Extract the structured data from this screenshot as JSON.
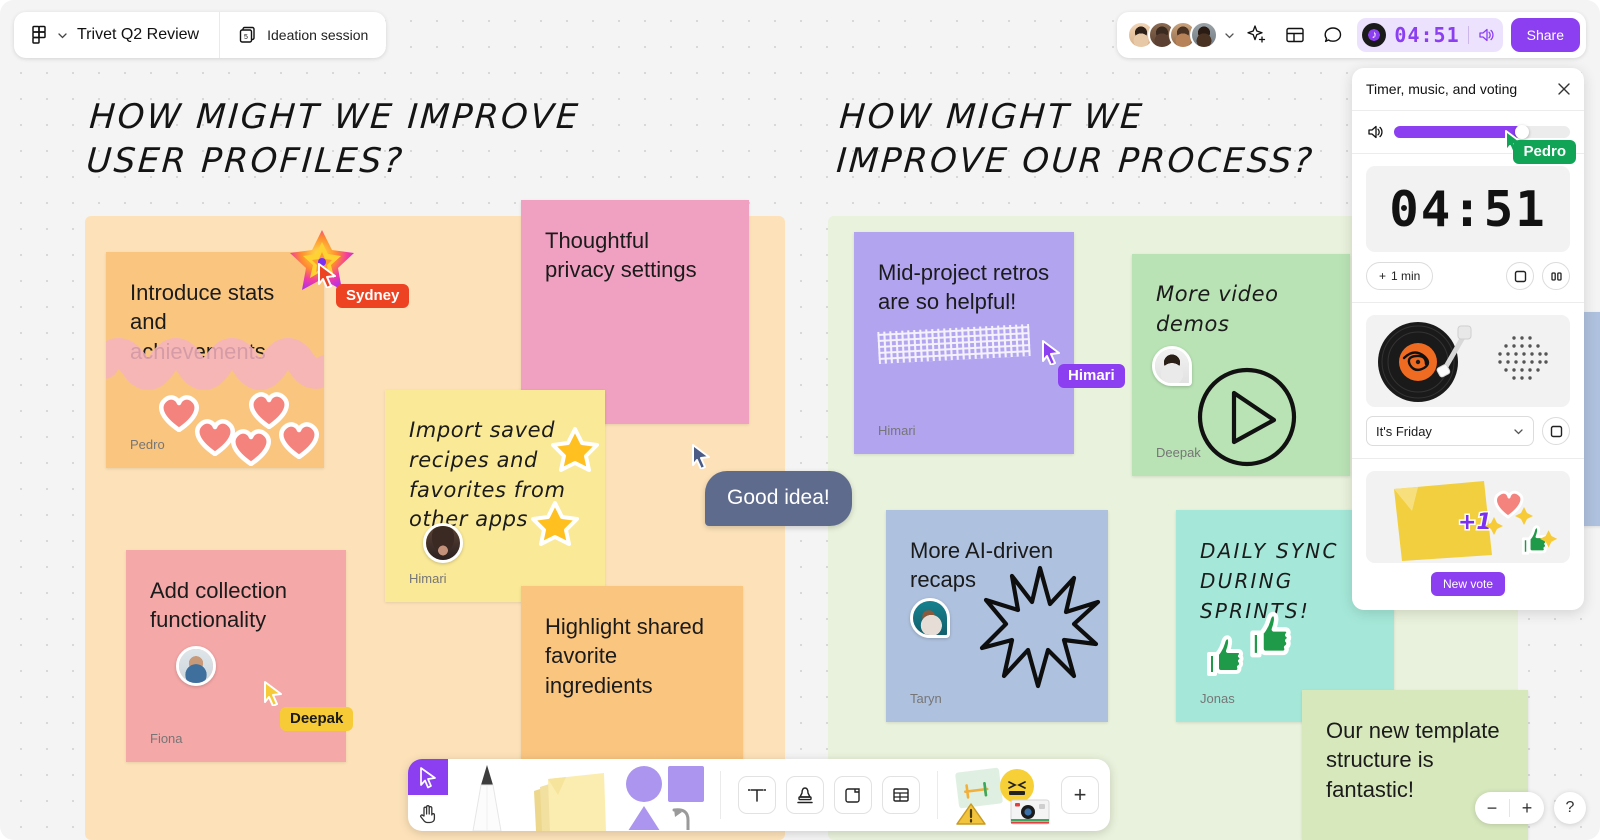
{
  "topbar": {
    "doc_title": "Trivet Q2 Review",
    "tab_label": "Ideation session",
    "tab_badge": "5",
    "timer_display": "04:51",
    "share_label": "Share",
    "icons": {
      "figjam_logo": "figjam-logo-icon",
      "chevron": "chevron-down-icon",
      "pages": "pages-icon",
      "sparkle": "sparkle-ai-icon",
      "template": "template-icon",
      "comment": "comment-bubble-icon",
      "music": "music-disc-icon",
      "volume": "volume-icon"
    }
  },
  "panel": {
    "title": "Timer, music, and voting",
    "close": "×",
    "volume_percent": 73,
    "timer": {
      "display": "04:51",
      "add_label": "1 min",
      "add_symbol": "+",
      "stop_label": "stop",
      "pause_label": "pause",
      "owner_cursor": "Pedro"
    },
    "music": {
      "track": "It's Friday"
    },
    "voting": {
      "new_vote_label": "New vote",
      "plus_one": "+1"
    }
  },
  "canvas": {
    "frames": [
      {
        "title": "HOW MIGHT WE IMPROVE\nUSER PROFILES?"
      },
      {
        "title": "HOW MIGHT WE\nIMPROVE OUR PROCESS?"
      }
    ],
    "notes": [
      {
        "text": "Introduce stats\nand achievements",
        "author": "Pedro",
        "color": "#fac57f"
      },
      {
        "text": "Thoughtful\nprivacy settings",
        "author": "",
        "color": "#f0a0c0"
      },
      {
        "text": "Import saved\nrecipes and\nfavorites from\nother apps",
        "author": "Himari",
        "color": "#fae996"
      },
      {
        "text": "Add collection\nfunctionality",
        "author": "Fiona",
        "color": "#f5a8a8"
      },
      {
        "text": "Highlight shared\nfavorite\ningredients",
        "author": "",
        "color": "#fac57f"
      },
      {
        "text": "Mid-project retros\nare so helpful!",
        "author": "Himari",
        "color": "#b3a4f0"
      },
      {
        "text": "More video\ndemos",
        "author": "Deepak",
        "color": "#b9e3b5"
      },
      {
        "text": "More AI-driven\nrecaps",
        "author": "Taryn",
        "color": "#aec1de"
      },
      {
        "text": "DAILY SYNC\nDURING\nSPRINTS!",
        "author": "Jonas",
        "color": "#a5e8d9"
      },
      {
        "text": "Our new template\nstructure is\nfantastic!",
        "author": "",
        "color": "#d7e8bd"
      }
    ],
    "speech": "Good idea!",
    "cursors": [
      {
        "name": "Sydney",
        "color": "#ee4323"
      },
      {
        "name": "Deepak",
        "color": "#f7cb37"
      },
      {
        "name": "Himari",
        "color": "#8b3ff0"
      },
      {
        "name": "Pedro",
        "color": "#12a456"
      }
    ]
  },
  "toolbar": {
    "tools": [
      "pointer-tool",
      "hand-tool",
      "pen-tool",
      "sticky-note-tool",
      "shapes-tool",
      "text-tool",
      "stamp-tool",
      "section-tool",
      "table-tool",
      "stickers-tool",
      "add-more-tool"
    ],
    "text_glyph": "T",
    "plus_glyph": "+"
  },
  "zoom_controls": {
    "minus": "−",
    "plus": "+",
    "help": "?"
  },
  "colors": {
    "accent": "#8b3ff0",
    "share": "#8b3ff0",
    "frame_left": "#fde2b9",
    "frame_right": "#e9f2dc"
  }
}
